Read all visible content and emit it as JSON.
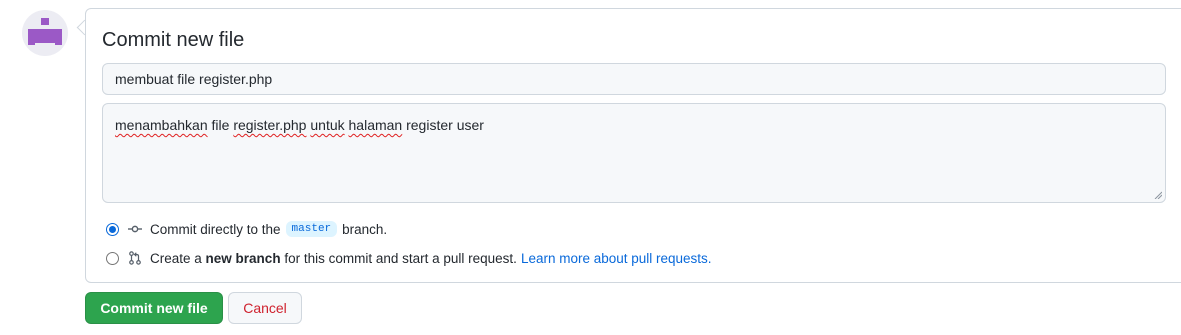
{
  "form": {
    "title": "Commit new file",
    "summary_value": "membuat file register.php",
    "description_words": [
      "menambahkan",
      "file",
      "register.php",
      "untuk",
      "halaman",
      "register",
      "user"
    ]
  },
  "options": {
    "direct": {
      "prefix": "Commit directly to the",
      "branch": "master",
      "suffix": "branch."
    },
    "new_branch": {
      "prefix": "Create a",
      "bold": "new branch",
      "suffix": "for this commit and start a pull request.",
      "link": "Learn more about pull requests."
    }
  },
  "buttons": {
    "commit": "Commit new file",
    "cancel": "Cancel"
  },
  "colors": {
    "primary": "#2da44e",
    "link": "#0969da",
    "danger": "#cf222e",
    "avatar": "#9b59c6"
  }
}
